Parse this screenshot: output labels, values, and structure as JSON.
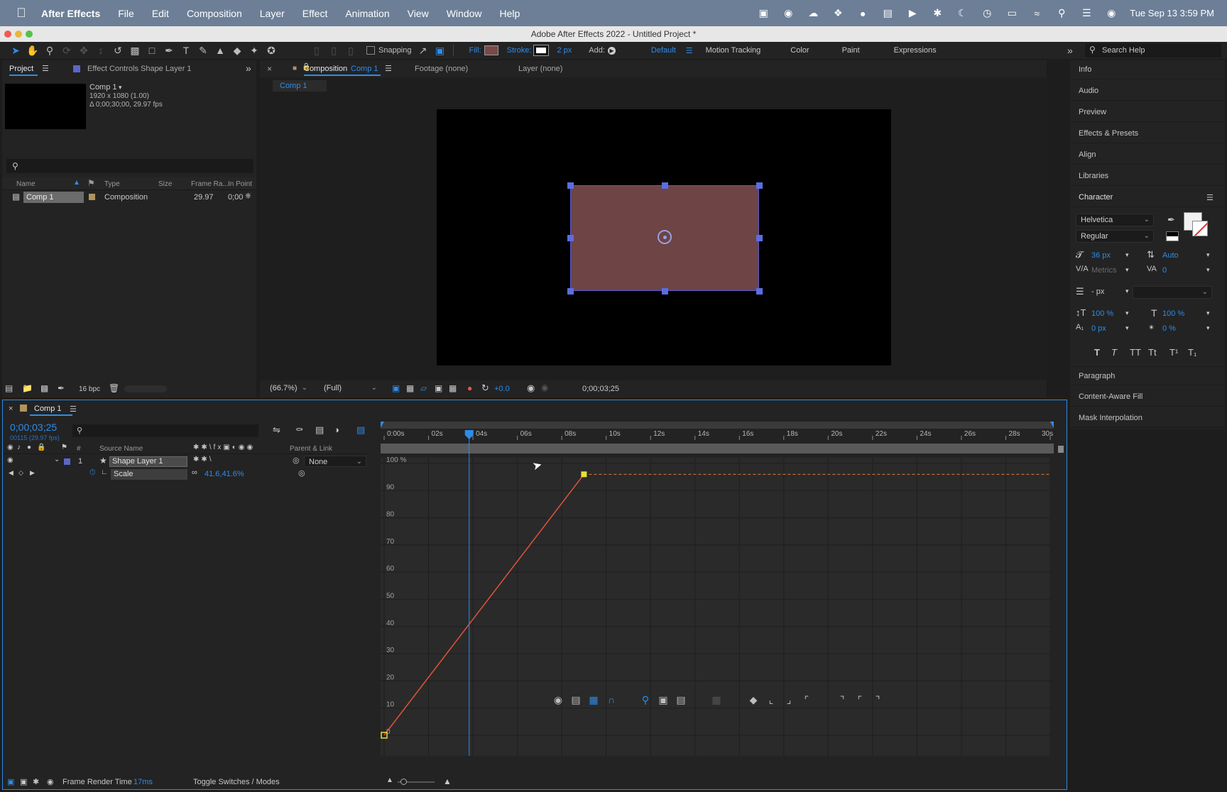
{
  "menubar": {
    "app_name": "After Effects",
    "items": [
      "File",
      "Edit",
      "Composition",
      "Layer",
      "Effect",
      "Animation",
      "View",
      "Window",
      "Help"
    ],
    "clock": "Tue Sep 13  3:59 PM"
  },
  "window": {
    "title": "Adobe After Effects 2022 - Untitled Project *"
  },
  "toolbar": {
    "snapping_label": "Snapping",
    "fill_label": "Fill:",
    "fill_color": "#7a4a4a",
    "stroke_label": "Stroke:",
    "stroke_width": "2 px",
    "add_label": "Add:",
    "workspaces": [
      "Default",
      "Motion Tracking",
      "Color",
      "Paint",
      "Expressions"
    ],
    "search_placeholder": "Search Help"
  },
  "project_panel": {
    "tab_project": "Project",
    "tab_effect_controls": "Effect Controls Shape Layer 1",
    "comp_name": "Comp 1",
    "comp_info_1": "1920 x 1080 (1.00)",
    "comp_info_2": "Δ 0;00;30;00, 29.97 fps",
    "columns": [
      "Name",
      "Type",
      "Size",
      "Frame Ra...",
      "In Point"
    ],
    "row": {
      "name": "Comp 1",
      "type": "Composition",
      "frame_rate": "29.97",
      "in_point": "0;00"
    },
    "bpc": "16 bpc"
  },
  "composition_panel": {
    "tab_close": "×",
    "tab_composition": "Composition",
    "tab_comp_name": "Comp 1",
    "tab_footage": "Footage (none)",
    "tab_layer": "Layer (none)",
    "breadcrumb": "Comp 1",
    "zoom": "(66.7%)",
    "resolution": "(Full)",
    "exposure": "+0.0",
    "timecode": "0;00;03;25",
    "shape_fill": "#6e4444"
  },
  "right_panel": {
    "items_top": [
      "Info",
      "Audio",
      "Preview",
      "Effects & Presets",
      "Align",
      "Libraries"
    ],
    "character_title": "Character",
    "font": "Helvetica",
    "style": "Regular",
    "font_size": "36 px",
    "leading": "Auto",
    "kerning": "Metrics",
    "tracking": "0",
    "stroke_px": "- px",
    "vert_scale": "100 %",
    "horiz_scale": "100 %",
    "baseline": "0 px",
    "tsume": "0 %",
    "text_styles": [
      "T",
      "T",
      "TT",
      "Tt",
      "T¹",
      "T₁"
    ],
    "items_bottom": [
      "Paragraph",
      "Content-Aware Fill",
      "Mask Interpolation"
    ]
  },
  "timeline": {
    "tab_name": "Comp 1",
    "timecode": "0;00;03;25",
    "frame_info": "00115 (29.97 fps)",
    "col_source_name": "Source Name",
    "col_hash": "#",
    "col_parent": "Parent & Link",
    "layer_number": "1",
    "layer_name": "Shape Layer 1",
    "parent_value": "None",
    "prop_name": "Scale",
    "prop_value": "41.6,41.6%",
    "ruler_labels": [
      "0:00s",
      "02s",
      "04s",
      "06s",
      "08s",
      "10s",
      "12s",
      "14s",
      "16s",
      "18s",
      "20s",
      "22s",
      "24s",
      "26s",
      "28s",
      "30s"
    ],
    "render_time_label": "Frame Render Time",
    "render_time_value": "17ms",
    "toggle_label": "Toggle Switches / Modes"
  },
  "chart_data": {
    "type": "line",
    "title": "",
    "xlabel": "",
    "ylabel": "",
    "y_labels": [
      "100 %",
      "90",
      "80",
      "70",
      "60",
      "50",
      "40",
      "30",
      "20",
      "10",
      "0"
    ],
    "xlim": [
      0,
      30
    ],
    "ylim": [
      0,
      100
    ],
    "keyframes": [
      {
        "t": 0,
        "v": 0
      },
      {
        "t": 9,
        "v": 96
      }
    ],
    "hold_value": 96,
    "playhead_time": 3.83,
    "curve_color": "#e0533a",
    "hold_color": "#e07a3a",
    "keyframe_color": "#e8e03a"
  }
}
